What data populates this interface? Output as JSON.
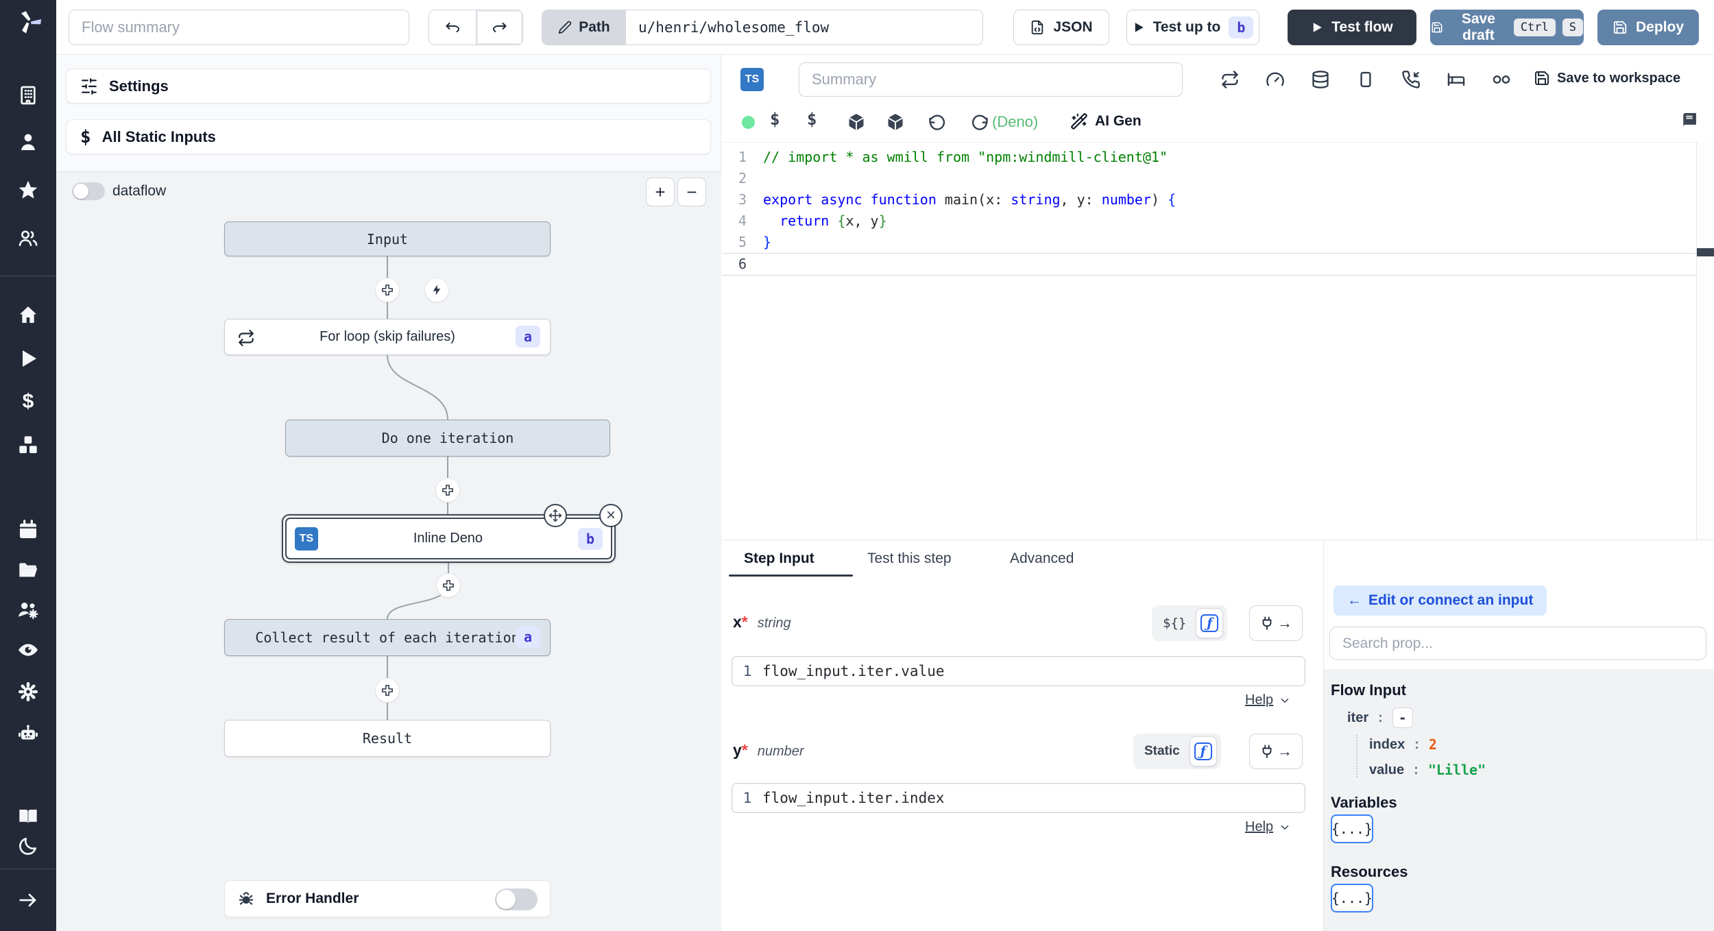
{
  "header": {
    "flow_summary_placeholder": "Flow summary",
    "path_label": "Path",
    "path_value": "u/henri/wholesome_flow",
    "json_button": "JSON",
    "test_up_to": "Test up to",
    "test_up_to_badge": "b",
    "test_flow": "Test flow",
    "save_draft": "Save draft",
    "kbd_ctrl": "Ctrl",
    "kbd_s": "S",
    "deploy": "Deploy"
  },
  "flow_panel": {
    "settings": "Settings",
    "all_static_inputs": "All Static Inputs",
    "dataflow_label": "dataflow",
    "zoom_in": "+",
    "zoom_out": "−",
    "error_handler": "Error Handler"
  },
  "graph": {
    "nodes": {
      "input": {
        "label": "Input"
      },
      "forloop": {
        "label": "For loop (skip failures)",
        "badge": "a"
      },
      "do_iteration": {
        "label": "Do one iteration"
      },
      "inline_deno": {
        "label": "Inline Deno",
        "badge": "b",
        "lang_badge": "TS"
      },
      "collect": {
        "label": "Collect result of each iteration",
        "badge": "a"
      },
      "result": {
        "label": "Result"
      }
    },
    "close_glyph": "×"
  },
  "editor": {
    "lang_badge": "TS",
    "summary_placeholder": "Summary",
    "save_to_workspace": "Save to workspace",
    "runtime": "(Deno)",
    "ai_gen": "AI Gen",
    "code_lines": [
      {
        "num": "1",
        "tokens": [
          {
            "t": "// import * as wmill from \"npm:windmill-client@1\"",
            "c": "cmt"
          }
        ]
      },
      {
        "num": "2",
        "tokens": []
      },
      {
        "num": "3",
        "tokens": [
          {
            "t": "export",
            "c": "kw"
          },
          {
            "t": " ",
            "c": "pln"
          },
          {
            "t": "async",
            "c": "kw"
          },
          {
            "t": " ",
            "c": "pln"
          },
          {
            "t": "function",
            "c": "kw"
          },
          {
            "t": " main",
            "c": "pln"
          },
          {
            "t": "(x",
            "c": "pln"
          },
          {
            "t": ": ",
            "c": "pln"
          },
          {
            "t": "string",
            "c": "type"
          },
          {
            "t": ", y",
            "c": "pln"
          },
          {
            "t": ": ",
            "c": "pln"
          },
          {
            "t": "number",
            "c": "type"
          },
          {
            "t": ") ",
            "c": "pln"
          },
          {
            "t": "{",
            "c": "b1"
          }
        ]
      },
      {
        "num": "4",
        "tokens": [
          {
            "t": "  ",
            "c": "pln"
          },
          {
            "t": "return",
            "c": "kw"
          },
          {
            "t": " ",
            "c": "pln"
          },
          {
            "t": "{",
            "c": "b2"
          },
          {
            "t": "x, y",
            "c": "pln"
          },
          {
            "t": "}",
            "c": "b2"
          }
        ]
      },
      {
        "num": "5",
        "tokens": [
          {
            "t": "}",
            "c": "b1"
          }
        ]
      },
      {
        "num": "6",
        "tokens": [],
        "current": true
      }
    ]
  },
  "step_panel": {
    "tabs": [
      "Step Input",
      "Test this step",
      "Advanced"
    ],
    "x": {
      "name": "x",
      "required": "*",
      "type": "string",
      "mode_left": "${}",
      "mode_right": "ƒ",
      "line_no": "1",
      "value": "flow_input.iter.value",
      "help": "Help"
    },
    "y": {
      "name": "y",
      "required": "*",
      "type": "number",
      "mode_left": "Static",
      "mode_right": "ƒ",
      "line_no": "1",
      "value": "flow_input.iter.index",
      "help": "Help"
    }
  },
  "props_panel": {
    "edit_connect": "Edit or connect an input",
    "edit_arrow": "←",
    "search_placeholder": "Search prop...",
    "flow_input_title": "Flow Input",
    "tree": {
      "iter_key": "iter",
      "colon": ":",
      "collapse": "-",
      "index_key": "index",
      "index_value": "2",
      "value_key": "value",
      "value_value": "\"Lille\""
    },
    "variables_title": "Variables",
    "variables_button": "{...}",
    "resources_title": "Resources",
    "resources_button": "{...}"
  },
  "icons": {
    "sidebar": [
      "windmill-logo",
      "building",
      "user",
      "star",
      "users",
      "home",
      "play",
      "dollar",
      "boxes",
      "calendar",
      "folder-open",
      "user-cog",
      "eye",
      "gear",
      "robot",
      "book-open",
      "moon",
      "arrow-right"
    ],
    "editor_toolbar": [
      "retry",
      "gauge",
      "database",
      "stop-rect",
      "phone-incoming",
      "sleep-bed",
      "mock",
      "save"
    ],
    "editor_secondary": [
      "status-dot",
      "dollar",
      "dollar",
      "box",
      "box",
      "undo",
      "reload",
      "wand-sparkles",
      "library-book"
    ]
  },
  "colors": {
    "sidebar_bg": "#232936",
    "steel_blue": "#6283a8",
    "dark_navy": "#2f3744",
    "badge_bg": "#e0e7ff",
    "badge_text": "#4338ca",
    "ts_blue": "#3178c6",
    "status_green": "#6ee7a0",
    "deno_green": "#57ba73",
    "number_orange": "#e8590c",
    "string_green": "#16a34a",
    "accent_blue": "#3b82f6",
    "link_blue": "#1d4ed8"
  }
}
